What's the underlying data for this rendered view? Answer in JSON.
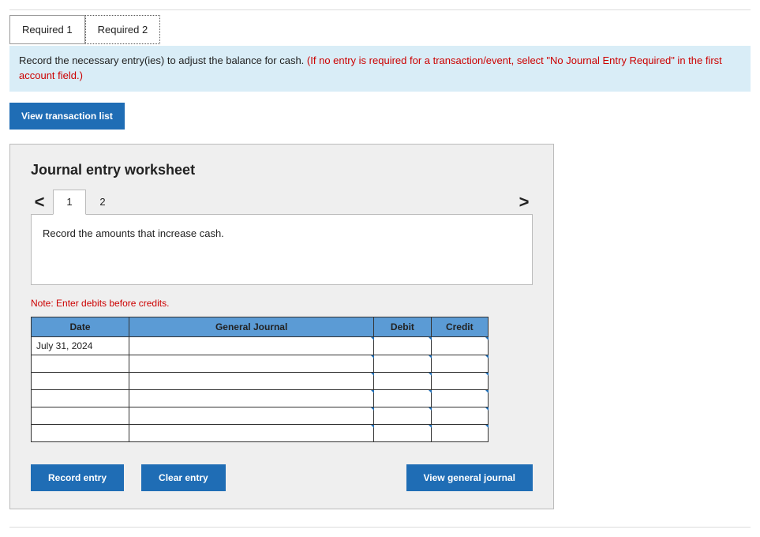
{
  "tabs": {
    "req1": "Required 1",
    "req2": "Required 2"
  },
  "instruction": {
    "main": "Record the necessary entry(ies) to adjust the balance for cash. ",
    "warning": "(If no entry is required for a transaction/event, select \"No Journal Entry Required\" in the first account field.)"
  },
  "buttons": {
    "view_transactions": "View transaction list",
    "record_entry": "Record entry",
    "clear_entry": "Clear entry",
    "view_general_journal": "View general journal"
  },
  "worksheet": {
    "title": "Journal entry worksheet",
    "prev": "<",
    "next": ">",
    "steps": {
      "s1": "1",
      "s2": "2"
    },
    "note_box": "Record the amounts that increase cash.",
    "note_red": "Note: Enter debits before credits."
  },
  "table": {
    "headers": {
      "date": "Date",
      "gj": "General Journal",
      "debit": "Debit",
      "credit": "Credit"
    },
    "rows": [
      {
        "date": "July 31, 2024",
        "gj": "",
        "debit": "",
        "credit": ""
      },
      {
        "date": "",
        "gj": "",
        "debit": "",
        "credit": ""
      },
      {
        "date": "",
        "gj": "",
        "debit": "",
        "credit": ""
      },
      {
        "date": "",
        "gj": "",
        "debit": "",
        "credit": ""
      },
      {
        "date": "",
        "gj": "",
        "debit": "",
        "credit": ""
      },
      {
        "date": "",
        "gj": "",
        "debit": "",
        "credit": ""
      }
    ]
  }
}
